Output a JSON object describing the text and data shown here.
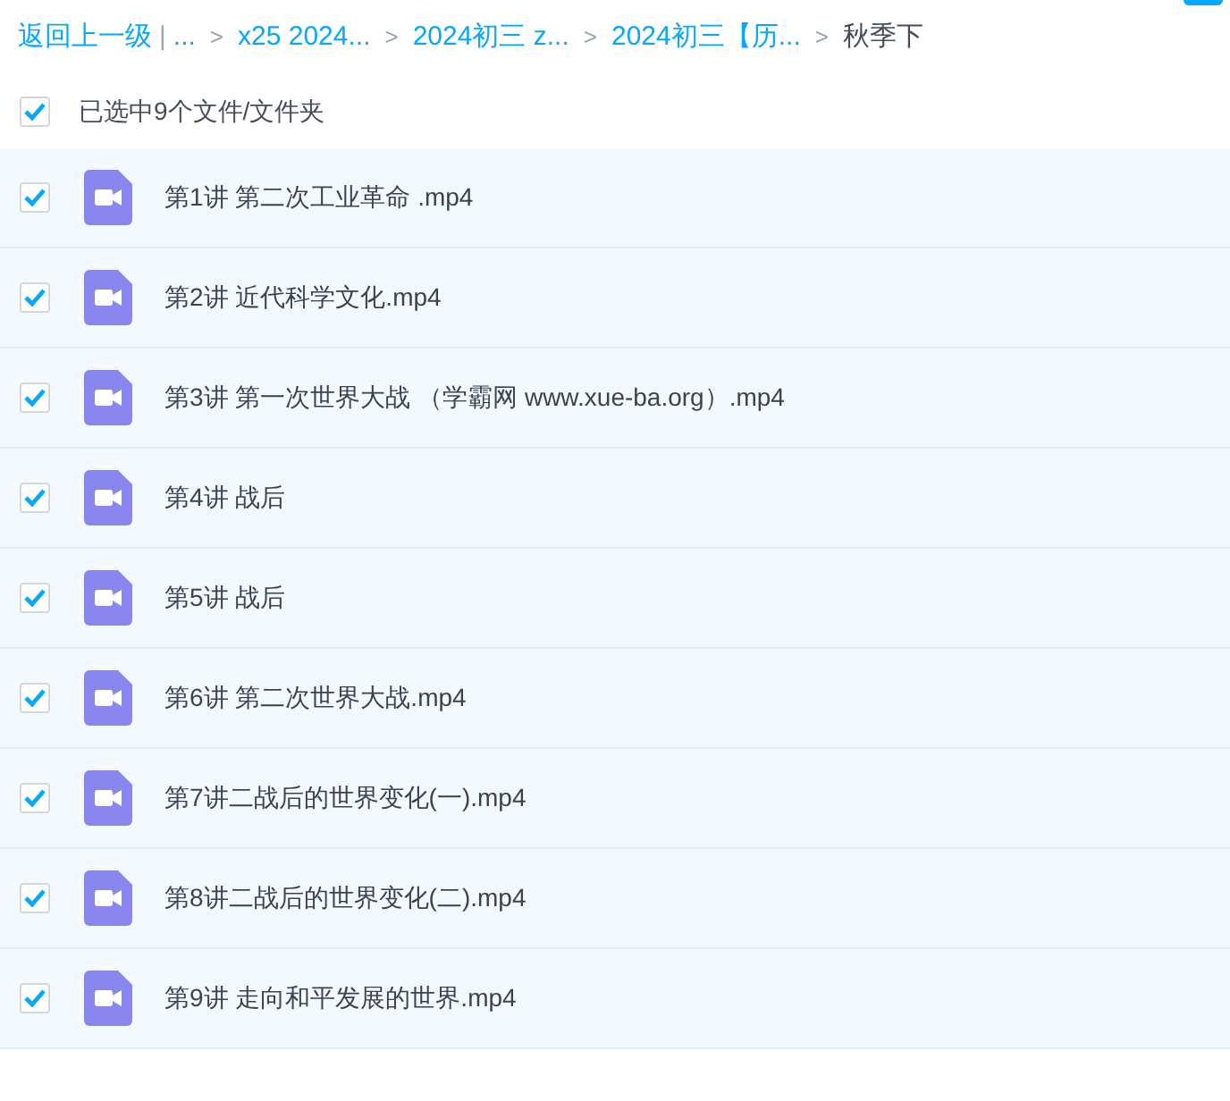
{
  "breadcrumb": {
    "back": "返回上一级",
    "divider": "|",
    "separator": ">",
    "items": [
      {
        "label": "...",
        "current": false
      },
      {
        "label": "x25 2024...",
        "current": false
      },
      {
        "label": "2024初三 z...",
        "current": false
      },
      {
        "label": "2024初三【历...",
        "current": false
      },
      {
        "label": "秋季下",
        "current": true
      }
    ]
  },
  "select_all": {
    "label": "已选中9个文件/文件夹",
    "checked": true
  },
  "files": [
    {
      "name": "第1讲 第二次工业革命 .mp4",
      "checked": true
    },
    {
      "name": "第2讲 近代科学文化.mp4",
      "checked": true
    },
    {
      "name": "第3讲 第一次世界大战 （学霸网 www.xue-ba.org）.mp4",
      "checked": true
    },
    {
      "name": "第4讲 战后",
      "checked": true
    },
    {
      "name": "第5讲 战后",
      "checked": true
    },
    {
      "name": "第6讲 第二次世界大战.mp4",
      "checked": true
    },
    {
      "name": "第7讲二战后的世界变化(一).mp4",
      "checked": true
    },
    {
      "name": "第8讲二战后的世界变化(二).mp4",
      "checked": true
    },
    {
      "name": "第9讲 走向和平发展的世界.mp4",
      "checked": true
    }
  ]
}
